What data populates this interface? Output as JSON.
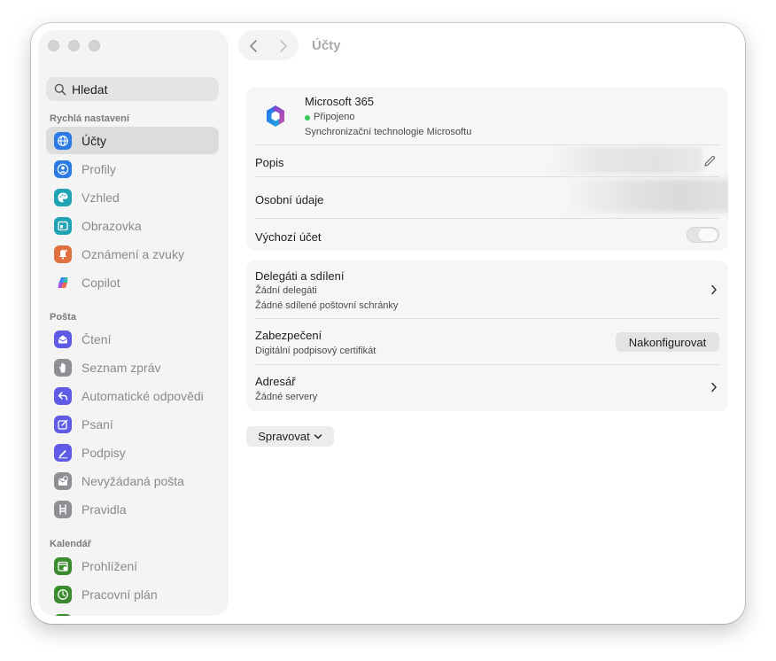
{
  "window": {
    "title": "Účty"
  },
  "sidebar": {
    "search_placeholder": "Hledat",
    "sections": [
      {
        "label": "Rychlá nastavení"
      },
      {
        "label": "Pošta"
      },
      {
        "label": "Kalendář"
      }
    ],
    "items": [
      {
        "label": "Účty",
        "icon": "globe-icon",
        "color": "#2a7be4",
        "selected": true
      },
      {
        "label": "Profily",
        "icon": "profile-icon",
        "color": "#2a7be4"
      },
      {
        "label": "Vzhled",
        "icon": "palette-icon",
        "color": "#1fa3b5"
      },
      {
        "label": "Obrazovka",
        "icon": "display-icon",
        "color": "#1fa3b5"
      },
      {
        "label": "Oznámení a zvuky",
        "icon": "bell-icon",
        "color": "#e0703f"
      },
      {
        "label": "Copilot",
        "icon": "copilot-icon",
        "color": "#ffffff"
      },
      {
        "label": "Čtení",
        "icon": "envelope-open-icon",
        "color": "#5e5ce6"
      },
      {
        "label": "Seznam zpráv",
        "icon": "hand-icon",
        "color": "#8e8e93"
      },
      {
        "label": "Automatické odpovědi",
        "icon": "reply-icon",
        "color": "#5e5ce6"
      },
      {
        "label": "Psaní",
        "icon": "compose-icon",
        "color": "#5e5ce6"
      },
      {
        "label": "Podpisy",
        "icon": "signature-icon",
        "color": "#5e5ce6"
      },
      {
        "label": "Nevyžádaná pošta",
        "icon": "junk-icon",
        "color": "#8e8e93"
      },
      {
        "label": "Pravidla",
        "icon": "rules-icon",
        "color": "#8e8e93"
      },
      {
        "label": "Prohlížení",
        "icon": "calendar-view-icon",
        "color": "#3a8a2e"
      },
      {
        "label": "Pracovní plán",
        "icon": "clock-icon",
        "color": "#3a8a2e"
      }
    ]
  },
  "account": {
    "name": "Microsoft 365",
    "status": "Připojeno",
    "status_color": "#34c759",
    "sync": "Synchronizační technologie Microsoftu"
  },
  "rows": {
    "description": "Popis",
    "personal": "Osobní údaje",
    "default_account": "Výchozí účet",
    "delegates_title": "Delegáti a sdílení",
    "delegates_sub1": "Žádní delegáti",
    "delegates_sub2": "Žádné sdílené poštovní schránky",
    "security_title": "Zabezpečení",
    "security_sub": "Digitální podpisový certifikát",
    "security_button": "Nakonfigurovat",
    "directory_title": "Adresář",
    "directory_sub": "Žádné servery"
  },
  "manage_button": "Spravovat"
}
